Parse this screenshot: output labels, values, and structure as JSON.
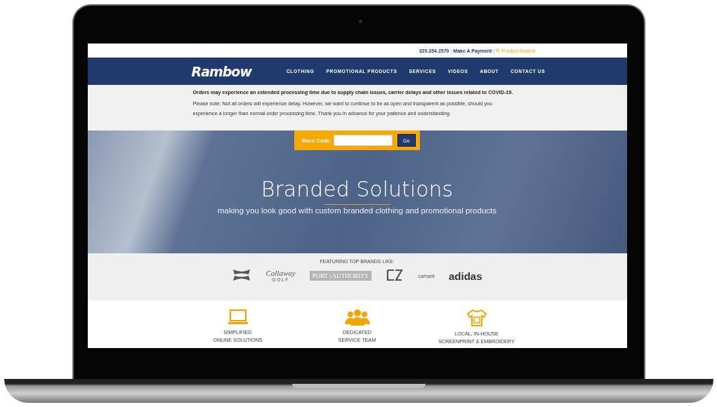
{
  "top_bar": {
    "phone": "320.354.2570",
    "separator": "|",
    "payment_link": "Make A Payment",
    "separator_2": "|",
    "search_link": "Product Search"
  },
  "nav": {
    "logo": "Rambow",
    "items": [
      {
        "label": "CLOTHING"
      },
      {
        "label": "PROMOTIONAL PRODUCTS"
      },
      {
        "label": "SERVICES"
      },
      {
        "label": "VIDEOS"
      },
      {
        "label": "ABOUT"
      },
      {
        "label": "CONTACT US"
      }
    ]
  },
  "notice": {
    "headline": "Orders may experience an extended processing time due to supply chain issues, carrier delays and other issues related to COVID-19.",
    "body": "Please note: Not all orders will experience delay. However, we want to continue to be as open and transparent as possible, should you experience a longer than normal order processing time. Thank you in advance for your patience and understanding."
  },
  "store_code": {
    "label": "Store Code:",
    "button": "Go"
  },
  "hero": {
    "title": "Branded Solutions",
    "subtitle": "making you look good with custom branded clothing and promotional products"
  },
  "brands": {
    "heading": "FEATURING TOP BRANDS LIKE:",
    "items": [
      {
        "kind": "ua"
      },
      {
        "kind": "callaway",
        "name": "Callaway",
        "sub": "GOLF"
      },
      {
        "kind": "port",
        "name": "PORT | AUTHORITY"
      },
      {
        "kind": "cb"
      },
      {
        "kind": "carhartt",
        "name": "carhartt"
      },
      {
        "kind": "adidas",
        "name": "adidas"
      }
    ]
  },
  "features": [
    {
      "kind": "laptop",
      "lines": [
        "SIMPLIFIED",
        "ONLINE SOLUTIONS"
      ]
    },
    {
      "kind": "people",
      "lines": [
        "DEDICATED",
        "SERVICE TEAM"
      ]
    },
    {
      "kind": "shirt",
      "lines": [
        "LOCAL, IN-HOUSE",
        "SCREENPRINT & EMBROIDERY"
      ]
    }
  ]
}
